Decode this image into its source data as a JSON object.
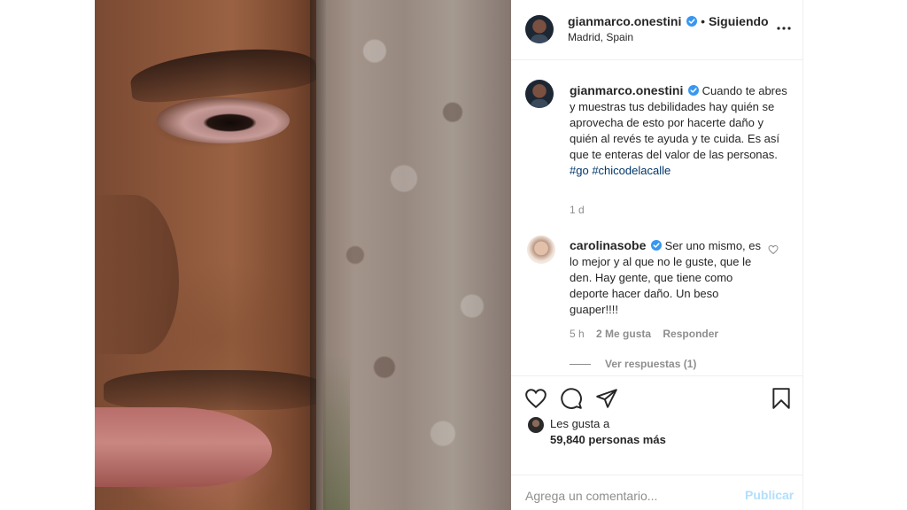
{
  "post": {
    "author": "gianmarco.onestini",
    "follow_status": "Siguiendo",
    "separator": "•",
    "location": "Madrid, Spain"
  },
  "caption": {
    "username": "gianmarco.onestini",
    "text": "Cuando te abres y muestras tus debilidades hay quién se aprovecha de esto por hacerte daño y quién al revés te ayuda y te cuida. Es así que te enteras del valor de las personas.",
    "hashtags": [
      "#go",
      "#chicodelacalle"
    ],
    "time": "1 d"
  },
  "comment": {
    "username": "carolinasobe",
    "text": "Ser uno mismo, es lo mejor y al que no le guste, que le den. Hay gente, que tiene como deporte hacer daño. Un beso guaper!!!!",
    "time": "5 h",
    "likes": "2 Me gusta",
    "reply_label": "Responder",
    "view_replies": "Ver respuestas (1)"
  },
  "likes": {
    "label": "Les gusta a",
    "count": "59,840 personas más"
  },
  "composer": {
    "placeholder": "Agrega un comentario...",
    "publish_label": "Publicar"
  },
  "colors": {
    "verified": "#3897f0",
    "hashtag": "#00376b",
    "publish_disabled": "#b2dffc",
    "secondary_text": "#8e8e8e"
  },
  "icons": {
    "like": "heart-icon",
    "comment": "comment-icon",
    "share": "paper-plane-icon",
    "save": "bookmark-icon",
    "more": "more-options-icon",
    "verified": "verified-badge-icon"
  }
}
